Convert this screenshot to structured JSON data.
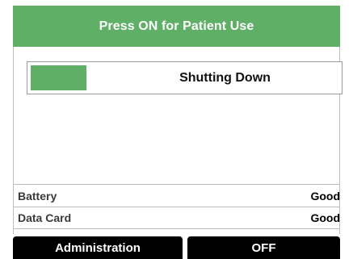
{
  "header": {
    "title": "Press ON for Patient Use"
  },
  "progress": {
    "label": "Shutting Down",
    "fraction": 0.18,
    "fill_color": "#5faf67"
  },
  "status": {
    "battery": {
      "label": "Battery",
      "value": "Good"
    },
    "data_card": {
      "label": "Data Card",
      "value": "Good"
    }
  },
  "softkeys": {
    "left_label": "Administration",
    "right_label": "OFF"
  },
  "colors": {
    "accent_green": "#5faf67",
    "softkey_bg": "#000000"
  }
}
